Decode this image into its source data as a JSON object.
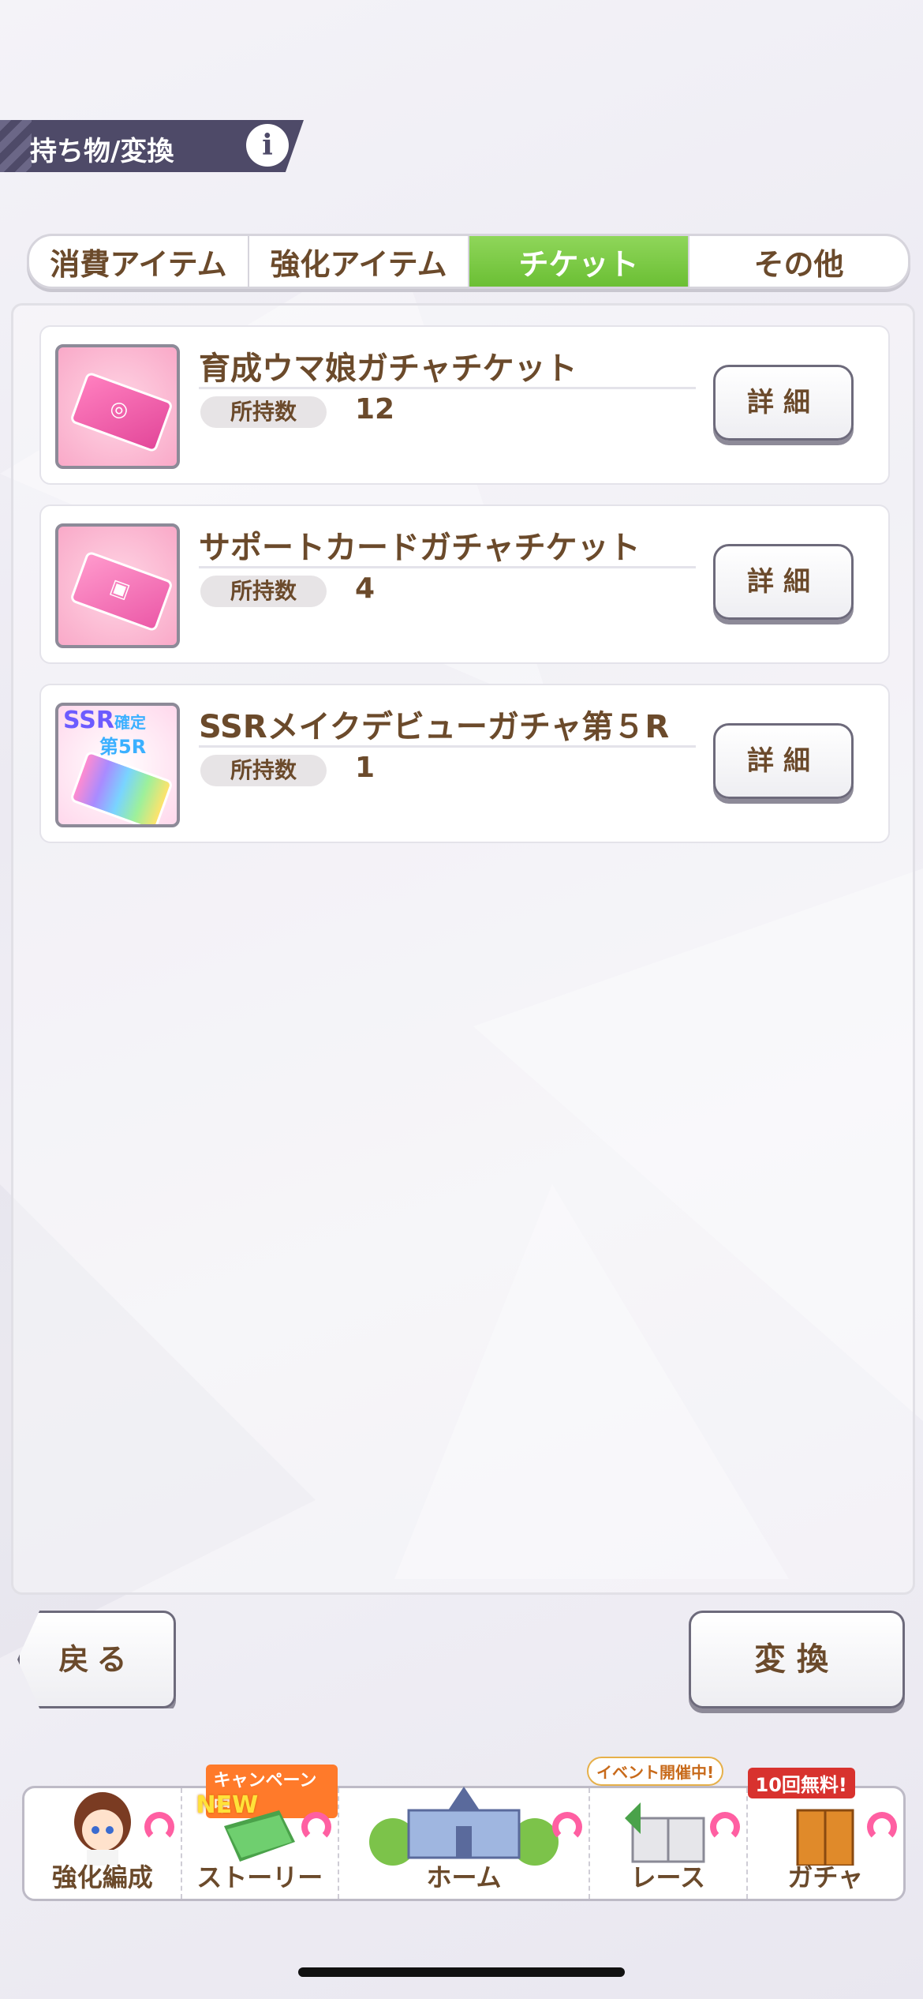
{
  "header": {
    "title": "持ち物/変換",
    "info_icon": "i"
  },
  "tabs": [
    {
      "label": "消費アイテム",
      "active": false
    },
    {
      "label": "強化アイテム",
      "active": false
    },
    {
      "label": "チケット",
      "active": true
    },
    {
      "label": "その他",
      "active": false
    }
  ],
  "items": [
    {
      "name": "育成ウマ娘ガチャチケット",
      "count_label": "所持数",
      "count": "12",
      "detail_label": "詳細",
      "icon": "pink-ticket-icon"
    },
    {
      "name": "サポートカードガチャチケット",
      "count_label": "所持数",
      "count": "4",
      "detail_label": "詳細",
      "icon": "support-ticket-icon"
    },
    {
      "name": "SSRメイクデビューガチャ第５R",
      "count_label": "所持数",
      "count": "1",
      "detail_label": "詳細",
      "icon": "ssr-ticket-icon",
      "icon_text": {
        "line1": "SSR",
        "line1b": "確定",
        "line2": "第5R"
      }
    }
  ],
  "buttons": {
    "back": "戻る",
    "convert": "変換"
  },
  "nav": [
    {
      "label": "強化編成",
      "badge": ""
    },
    {
      "label": "ストーリー",
      "badge": "キャンペーン中",
      "badge2": "NEW"
    },
    {
      "label": "ホーム",
      "badge": ""
    },
    {
      "label": "レース",
      "badge": "イベント開催中!"
    },
    {
      "label": "ガチャ",
      "badge": "10回無料!"
    }
  ],
  "colors": {
    "accent_green": "#6bbf34",
    "text_brown": "#6b4a2b",
    "header_bg": "#4e4a68"
  }
}
